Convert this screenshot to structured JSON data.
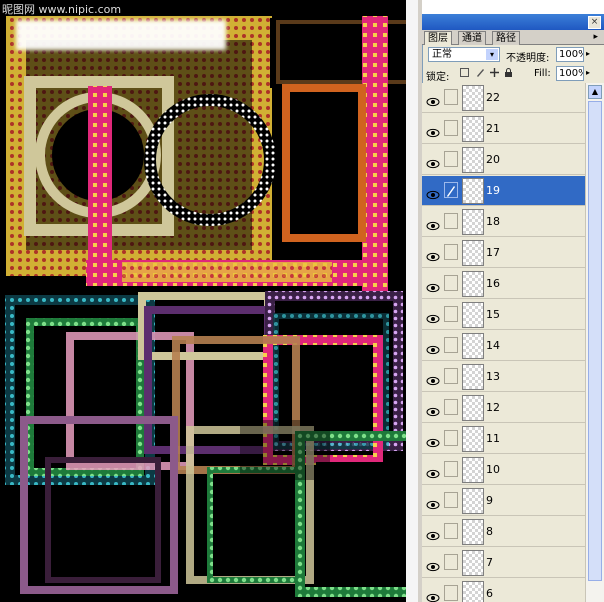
{
  "watermark": {
    "text": "昵图网 www.nipic.com"
  },
  "panel": {
    "tabs": [
      {
        "label": "图层",
        "active": true
      },
      {
        "label": "通道",
        "active": false
      },
      {
        "label": "路径",
        "active": false
      }
    ],
    "menu_glyph": "▸",
    "close_glyph": "×",
    "blend_mode": "正常",
    "opacity_label": "不透明度:",
    "opacity_value": "100%",
    "lock_label": "锁定:",
    "fill_label": "Fill:",
    "fill_value": "100%",
    "dropdown_glyph": "▾",
    "arrow_glyph": "▸",
    "lock_icons": [
      "transparency-lock-icon",
      "brush-lock-icon",
      "move-lock-icon",
      "padlock-icon"
    ]
  },
  "layers": [
    {
      "name": "22",
      "visible": true,
      "selected": false
    },
    {
      "name": "21",
      "visible": true,
      "selected": false
    },
    {
      "name": "20",
      "visible": true,
      "selected": false
    },
    {
      "name": "19",
      "visible": true,
      "selected": true
    },
    {
      "name": "18",
      "visible": true,
      "selected": false
    },
    {
      "name": "17",
      "visible": true,
      "selected": false
    },
    {
      "name": "16",
      "visible": true,
      "selected": false
    },
    {
      "name": "15",
      "visible": true,
      "selected": false
    },
    {
      "name": "14",
      "visible": true,
      "selected": false
    },
    {
      "name": "13",
      "visible": true,
      "selected": false
    },
    {
      "name": "12",
      "visible": true,
      "selected": false
    },
    {
      "name": "11",
      "visible": true,
      "selected": false
    },
    {
      "name": "10",
      "visible": true,
      "selected": false
    },
    {
      "name": "9",
      "visible": true,
      "selected": false
    },
    {
      "name": "8",
      "visible": true,
      "selected": false
    },
    {
      "name": "7",
      "visible": true,
      "selected": false
    },
    {
      "name": "6",
      "visible": true,
      "selected": false
    }
  ],
  "colors": {
    "selection": "#316ac5",
    "panel_bg": "#ece9d8",
    "canvas_bg": "#000000",
    "frame_gold": "#e8c33a",
    "frame_pink": "#e0287a",
    "frame_green": "#3fae5a",
    "frame_teal": "#2a9da8",
    "frame_tan": "#cfc79a",
    "frame_lilac": "#b98bd6"
  }
}
